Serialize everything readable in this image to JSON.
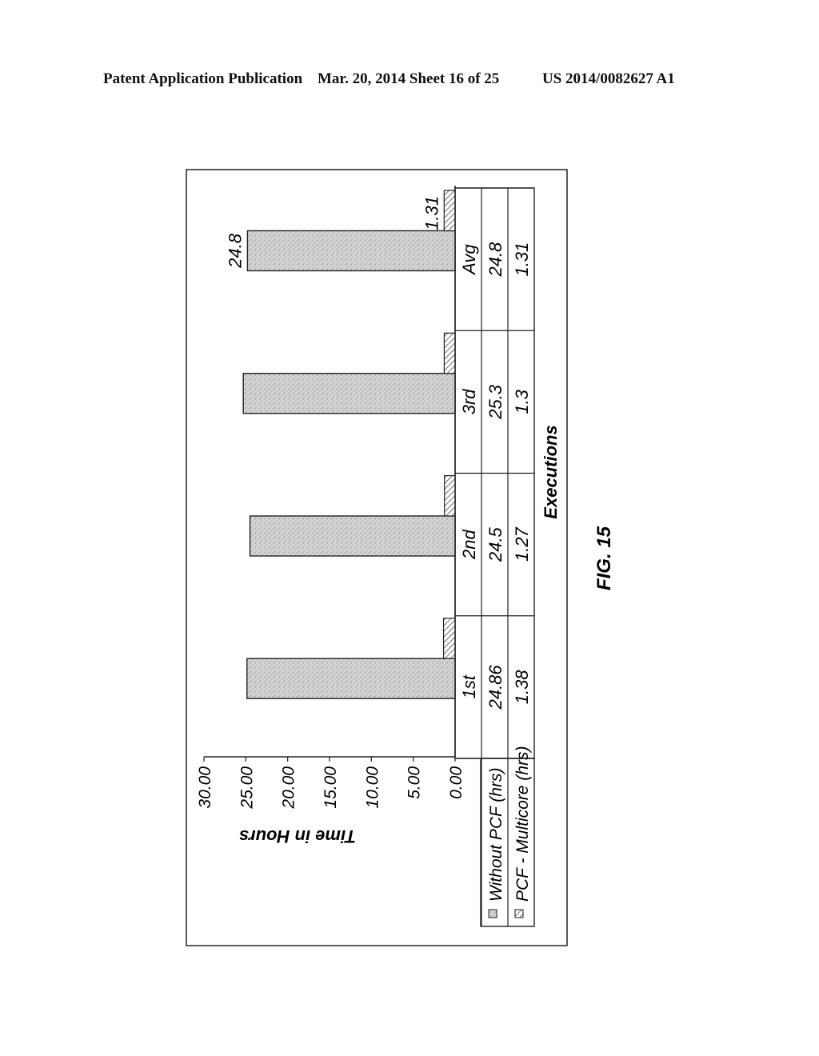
{
  "header": {
    "publication": "Patent Application Publication",
    "date_sheet": "Mar. 20, 2014  Sheet 16 of 25",
    "patent_number": "US 2014/0082627 A1"
  },
  "figure_label": "FIG. 15",
  "chart_data": {
    "type": "bar",
    "orientation": "rotated-90",
    "title": "",
    "xlabel": "Executions",
    "ylabel": "Time in Hours",
    "ylim": [
      0,
      30
    ],
    "yticks": [
      "0.00",
      "5.00",
      "10.00",
      "15.00",
      "20.00",
      "25.00",
      "30.00"
    ],
    "categories": [
      "1st",
      "2nd",
      "3rd",
      "Avg"
    ],
    "series": [
      {
        "name": "Without PCF (hrs)",
        "pattern": "stipple",
        "values": [
          24.86,
          24.5,
          25.3,
          24.8
        ]
      },
      {
        "name": "PCF - Multicore (hrs)",
        "pattern": "hatch",
        "values": [
          1.38,
          1.27,
          1.3,
          1.31
        ]
      }
    ],
    "data_labels": {
      "category": "Avg",
      "values": [
        "24.8",
        "1.31"
      ]
    },
    "data_table": {
      "rows": [
        {
          "legend": "Without PCF (hrs)",
          "cells": [
            "24.86",
            "24.5",
            "25.3",
            "24.8"
          ]
        },
        {
          "legend": "PCF - Multicore (hrs)",
          "cells": [
            "1.38",
            "1.27",
            "1.3",
            "1.31"
          ]
        }
      ]
    },
    "grid": false,
    "legend": "data-table"
  }
}
